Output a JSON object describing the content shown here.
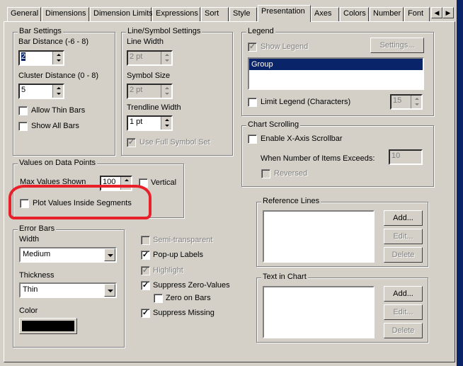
{
  "tabs": [
    "General",
    "Dimensions",
    "Dimension Limits",
    "Expressions",
    "Sort",
    "Style",
    "Presentation",
    "Axes",
    "Colors",
    "Number",
    "Font"
  ],
  "active_tab": "Presentation",
  "bar_settings": {
    "title": "Bar Settings",
    "bar_distance_label": "Bar Distance (-6 - 8)",
    "bar_distance": "2",
    "cluster_distance_label": "Cluster Distance (0 - 8)",
    "cluster_distance": "5",
    "allow_thin_bars": "Allow Thin Bars",
    "show_all_bars": "Show All Bars"
  },
  "line_symbol": {
    "title": "Line/Symbol Settings",
    "line_width_label": "Line Width",
    "line_width": "2 pt",
    "symbol_size_label": "Symbol Size",
    "symbol_size": "2 pt",
    "trendline_width_label": "Trendline Width",
    "trendline_width": "1 pt",
    "use_full_symbol_set": "Use Full Symbol Set"
  },
  "values_on_data_points": {
    "title": "Values on Data Points",
    "max_values_label": "Max Values Shown",
    "max_values": "100",
    "vertical": "Vertical",
    "plot_inside": "Plot Values Inside Segments"
  },
  "highlight_color": "#e8202a",
  "error_bars": {
    "title": "Error Bars",
    "width_label": "Width",
    "width": "Medium",
    "thickness_label": "Thickness",
    "thickness": "Thin",
    "color_label": "Color",
    "color": "#000000"
  },
  "options": {
    "semi_transparent": "Semi-transparent",
    "popup_labels": "Pop-up Labels",
    "highlight": "Highlight",
    "suppress_zero": "Suppress Zero-Values",
    "zero_on_bars": "Zero on Bars",
    "suppress_missing": "Suppress Missing"
  },
  "legend": {
    "title": "Legend",
    "show_legend": "Show Legend",
    "settings": "Settings...",
    "items": [
      "Group"
    ],
    "limit_legend": "Limit Legend (Characters)",
    "limit_value": "15"
  },
  "chart_scrolling": {
    "title": "Chart Scrolling",
    "enable": "Enable X-Axis Scrollbar",
    "when_label": "When Number of Items Exceeds:",
    "when_value": "10",
    "reversed": "Reversed"
  },
  "reference_lines": {
    "title": "Reference Lines",
    "add": "Add...",
    "edit": "Edit...",
    "delete": "Delete"
  },
  "text_in_chart": {
    "title": "Text in Chart",
    "add": "Add...",
    "edit": "Edit...",
    "delete": "Delete"
  }
}
